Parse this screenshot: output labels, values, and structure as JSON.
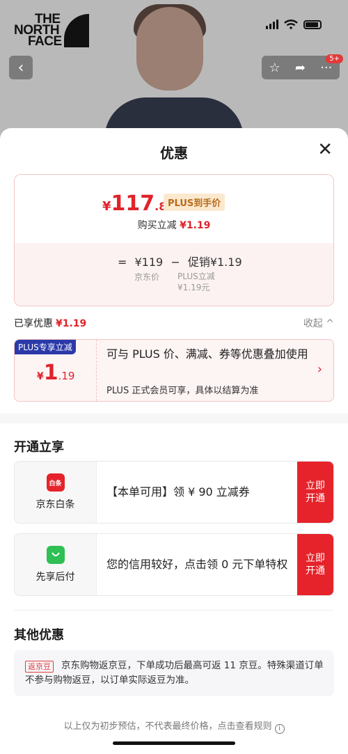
{
  "brand": {
    "line1": "THE",
    "line2": "NORTH",
    "line3": "FACE"
  },
  "top_badge": "5+",
  "sheet": {
    "title": "优惠"
  },
  "price_card": {
    "currency": "¥",
    "final_int": "117",
    "final_dec": ".81",
    "plus_tag": "PLUS到手价",
    "buy_reduce_label": "购买立减",
    "buy_reduce_value": "¥1.19",
    "formula_eq": "=",
    "formula_price": "¥119",
    "formula_minus": "−",
    "formula_promo": "促销¥1.19",
    "label_jd_price": "京东价",
    "label_plus_1": "PLUS立减",
    "label_plus_2": "¥1.19元"
  },
  "enjoyed": {
    "label": "已享优惠",
    "value": "¥1.19",
    "collapse": "收起 ^"
  },
  "plus_card": {
    "tag": "PLUS专享立减",
    "currency": "¥",
    "int": "1",
    "dec": ".19",
    "desc": "可与 PLUS 价、满减、券等优惠叠加使用",
    "sub": "PLUS 正式会员可享，具体以结算为准",
    "chevron": "›"
  },
  "open_section": {
    "title": "开通立享",
    "services": [
      {
        "icon_text": "白条",
        "name": "京东白条",
        "text": "【本单可用】领 ¥ 90 立减券",
        "button": "立即开通",
        "color": "#e6232b"
      },
      {
        "icon_text": "",
        "name": "先享后付",
        "text": "您的信用较好，点击领 0 元下单特权",
        "button": "立即开通",
        "color": "#2fbf55"
      }
    ]
  },
  "other_section": {
    "title": "其他优惠",
    "tag": "返京豆",
    "text": "京东购物返京豆，下单成功后最高可返 11 京豆。特殊渠道订单不参与购物返豆，以订单实际返豆为准。"
  },
  "footer": {
    "note": "以上仅为初步预估，不代表最终价格，点击查看规则",
    "info": "i"
  }
}
